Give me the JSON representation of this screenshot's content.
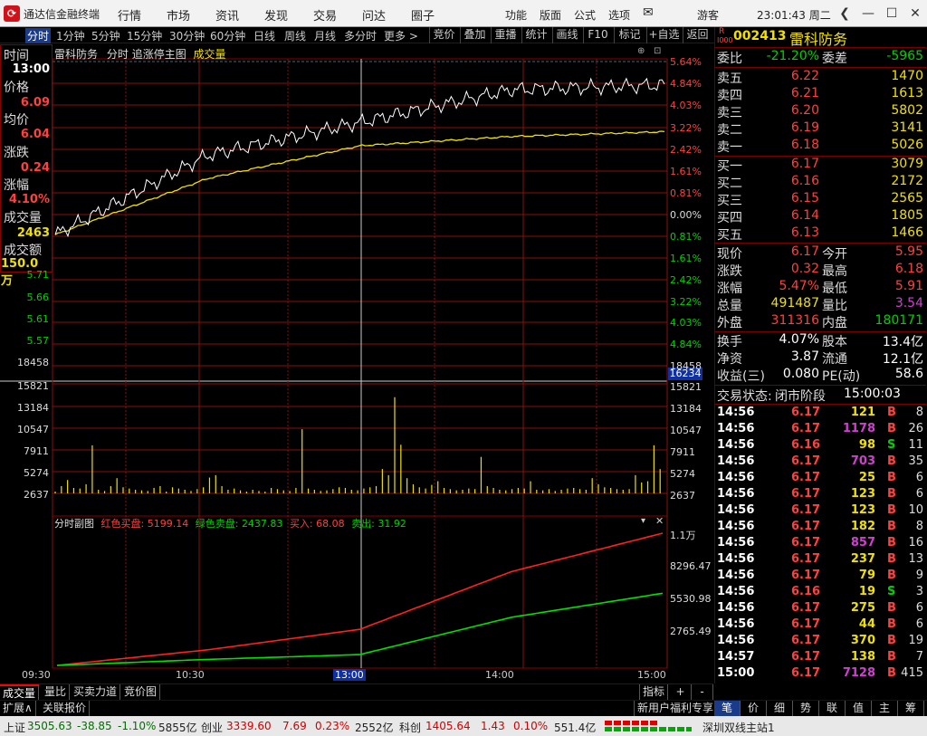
{
  "window": {
    "title": "通达信金融终端",
    "menus": [
      "行情",
      "市场",
      "资讯",
      "发现",
      "交易",
      "问达",
      "圈子"
    ],
    "sys_menus": [
      "功能",
      "版面",
      "公式",
      "选项"
    ],
    "user": "游客",
    "clock": "23:01:43 周二"
  },
  "toolbar": {
    "left": [
      "分时",
      "1分钟",
      "5分钟",
      "15分钟",
      "30分钟",
      "60分钟",
      "日线",
      "周线",
      "月线",
      "多分时",
      "更多 >"
    ],
    "right": [
      "竞价",
      "叠加",
      "重播",
      "统计",
      "画线",
      "F10",
      "标记",
      "+自选",
      "返回"
    ]
  },
  "chart": {
    "header": {
      "name": "雷科防务",
      "mode": "分时",
      "main": "追涨停主图",
      "vol": "成交量"
    },
    "info": [
      {
        "label": "时间",
        "value": "13:00",
        "color": "#ffffff"
      },
      {
        "label": "价格",
        "value": "6.09",
        "color": "#ff4040"
      },
      {
        "label": "均价",
        "value": "6.04",
        "color": "#ff4040"
      },
      {
        "label": "涨跌",
        "value": "0.24",
        "color": "#ff4040"
      },
      {
        "label": "涨幅",
        "value": "4.10%",
        "color": "#ff4040"
      },
      {
        "label": "成交量",
        "value": "2463",
        "color": "#f0e000"
      },
      {
        "label": "成交额",
        "value": "150.0万",
        "color": "#f0e000"
      }
    ],
    "left_price_ticks": [
      "5.71",
      "5.66",
      "5.61",
      "5.57",
      "18458",
      "15821",
      "13184",
      "10547",
      "7911",
      "5274",
      "2637"
    ],
    "right_pct_ticks": [
      "5.64%",
      "4.84%",
      "4.03%",
      "3.22%",
      "2.42%",
      "1.61%",
      "0.81%",
      "0.00%",
      "0.81%",
      "1.61%",
      "2.42%",
      "3.22%",
      "4.03%",
      "4.84%",
      "18458",
      "15821",
      "13184",
      "10547",
      "7911",
      "5274",
      "2637"
    ],
    "right_vol_highlight": "16234",
    "sub": {
      "title": "分时副图",
      "red_label": "红色买盘:",
      "red_val": "5199.14",
      "green_label": "绿色卖盘:",
      "green_val": "2437.83",
      "buy_label": "买入:",
      "buy_val": "68.08",
      "sell_label": "卖出:",
      "sell_val": "31.92",
      "ticks": [
        "1.1万",
        "8296.47",
        "5530.98",
        "2765.49"
      ]
    },
    "times": [
      "09:30",
      "10:30",
      "13:00",
      "14:00",
      "15:00"
    ]
  },
  "chart_data": {
    "type": "line",
    "title": "雷科防务 分时",
    "x": [
      "09:30",
      "10:30",
      "13:00",
      "14:00",
      "15:00"
    ],
    "series": [
      {
        "name": "价格",
        "color": "#ffffff",
        "values": [
          5.85,
          6.02,
          6.09,
          6.16,
          6.17
        ]
      },
      {
        "name": "均价",
        "color": "#f0e000",
        "values": [
          5.85,
          5.97,
          6.04,
          6.06,
          6.07
        ]
      },
      {
        "name": "红色买盘",
        "color": "#ff2020",
        "values": [
          0,
          1300,
          3000,
          7800,
          11000
        ]
      },
      {
        "name": "绿色卖盘",
        "color": "#00e000",
        "values": [
          0,
          500,
          900,
          4000,
          6000
        ]
      }
    ],
    "volume": [
      300,
      1200,
      2200,
      900,
      800,
      1500,
      7900,
      600,
      400,
      1200,
      2500,
      1000,
      800,
      600,
      500,
      400,
      900,
      1200,
      300,
      1000,
      800,
      600,
      400,
      700,
      1000,
      2600,
      3000,
      1200,
      600,
      800,
      500,
      300,
      600,
      400,
      300,
      900,
      700,
      500,
      400,
      900,
      10547,
      800,
      600,
      400,
      500,
      700,
      1000,
      900,
      600,
      500,
      800,
      1000,
      1200,
      4000,
      3000,
      15821,
      8000,
      2500,
      1500,
      1000,
      800,
      1400,
      2000,
      900,
      700,
      500,
      600,
      800,
      700,
      6000,
      1200,
      900,
      600,
      500,
      700,
      900,
      800,
      2000,
      600,
      500,
      700,
      400,
      600,
      800,
      900,
      700,
      600,
      2500,
      1500,
      1000,
      900,
      700,
      600,
      700,
      3000,
      1800,
      2000,
      7911,
      4000
    ],
    "ylim": [
      5.57,
      6.22
    ],
    "grid": true
  },
  "orderbook": {
    "code": "002413",
    "name": "雷科防务",
    "wb": {
      "label": "委比",
      "value": "-21.20%"
    },
    "wc": {
      "label": "委差",
      "value": "-5965"
    },
    "sells": [
      {
        "label": "卖五",
        "price": "6.22",
        "vol": "1470"
      },
      {
        "label": "卖四",
        "price": "6.21",
        "vol": "1613"
      },
      {
        "label": "卖三",
        "price": "6.20",
        "vol": "5802"
      },
      {
        "label": "卖二",
        "price": "6.19",
        "vol": "3141"
      },
      {
        "label": "卖一",
        "price": "6.18",
        "vol": "5026"
      }
    ],
    "buys": [
      {
        "label": "买一",
        "price": "6.17",
        "vol": "3079"
      },
      {
        "label": "买二",
        "price": "6.16",
        "vol": "2172"
      },
      {
        "label": "买三",
        "price": "6.15",
        "vol": "2565"
      },
      {
        "label": "买四",
        "price": "6.14",
        "vol": "1805"
      },
      {
        "label": "买五",
        "price": "6.13",
        "vol": "1466"
      }
    ]
  },
  "quote": [
    {
      "l": "现价",
      "v": "6.17",
      "vc": "#ff4040",
      "l2": "今开",
      "v2": "5.95",
      "vc2": "#ff4040"
    },
    {
      "l": "涨跌",
      "v": "0.32",
      "vc": "#ff4040",
      "l2": "最高",
      "v2": "6.18",
      "vc2": "#ff4040"
    },
    {
      "l": "涨幅",
      "v": "5.47%",
      "vc": "#ff4040",
      "l2": "最低",
      "v2": "5.91",
      "vc2": "#ff4040"
    },
    {
      "l": "总量",
      "v": "491487",
      "vc": "#f0e000",
      "l2": "量比",
      "v2": "3.54",
      "vc2": "#d040d0"
    },
    {
      "l": "外盘",
      "v": "311316",
      "vc": "#ff4040",
      "l2": "内盘",
      "v2": "180171",
      "vc2": "#00d000"
    }
  ],
  "quote2": [
    {
      "l": "换手",
      "v": "4.07%",
      "l2": "股本",
      "v2": "13.4亿"
    },
    {
      "l": "净资",
      "v": "3.87",
      "l2": "流通",
      "v2": "12.1亿"
    },
    {
      "l": "收益(三)",
      "v": "0.080",
      "l2": "PE(动)",
      "v2": "58.6"
    }
  ],
  "trade_status": {
    "label": "交易状态:",
    "value": "闭市阶段",
    "time": "15:00:03"
  },
  "ticks": [
    {
      "t": "14:56",
      "p": "6.17",
      "v": "121",
      "vc": "#f0e000",
      "s": "B",
      "n": "8"
    },
    {
      "t": "14:56",
      "p": "6.17",
      "v": "1178",
      "vc": "#d040d0",
      "s": "B",
      "n": "26"
    },
    {
      "t": "14:56",
      "p": "6.16",
      "v": "98",
      "vc": "#f0e000",
      "s": "S",
      "n": "11"
    },
    {
      "t": "14:56",
      "p": "6.17",
      "v": "703",
      "vc": "#d040d0",
      "s": "B",
      "n": "35"
    },
    {
      "t": "14:56",
      "p": "6.17",
      "v": "25",
      "vc": "#f0e000",
      "s": "B",
      "n": "6"
    },
    {
      "t": "14:56",
      "p": "6.17",
      "v": "123",
      "vc": "#f0e000",
      "s": "B",
      "n": "6"
    },
    {
      "t": "14:56",
      "p": "6.17",
      "v": "123",
      "vc": "#f0e000",
      "s": "B",
      "n": "10"
    },
    {
      "t": "14:56",
      "p": "6.17",
      "v": "182",
      "vc": "#f0e000",
      "s": "B",
      "n": "8"
    },
    {
      "t": "14:56",
      "p": "6.17",
      "v": "857",
      "vc": "#d040d0",
      "s": "B",
      "n": "16"
    },
    {
      "t": "14:56",
      "p": "6.17",
      "v": "237",
      "vc": "#f0e000",
      "s": "B",
      "n": "13"
    },
    {
      "t": "14:56",
      "p": "6.17",
      "v": "79",
      "vc": "#f0e000",
      "s": "B",
      "n": "9"
    },
    {
      "t": "14:56",
      "p": "6.16",
      "v": "19",
      "vc": "#f0e000",
      "s": "S",
      "n": "3"
    },
    {
      "t": "14:56",
      "p": "6.17",
      "v": "275",
      "vc": "#f0e000",
      "s": "B",
      "n": "6"
    },
    {
      "t": "14:56",
      "p": "6.17",
      "v": "44",
      "vc": "#f0e000",
      "s": "B",
      "n": "6"
    },
    {
      "t": "14:56",
      "p": "6.17",
      "v": "370",
      "vc": "#f0e000",
      "s": "B",
      "n": "19"
    },
    {
      "t": "14:57",
      "p": "6.17",
      "v": "138",
      "vc": "#f0e000",
      "s": "B",
      "n": "7"
    },
    {
      "t": "15:00",
      "p": "6.17",
      "v": "7128",
      "vc": "#d040d0",
      "s": "B",
      "n": "415"
    }
  ],
  "bottom_tabs": [
    "成交量",
    "量比",
    "买卖力道",
    "竞价图"
  ],
  "bottom_right": [
    "指标",
    "+",
    "-"
  ],
  "bottom2": {
    "left": [
      "扩展∧",
      "关联报价"
    ],
    "promo": "新用户福利专享",
    "right_tabs": [
      "笔",
      "价",
      "细",
      "势",
      "联",
      "值",
      "主",
      "筹"
    ]
  },
  "status": {
    "sh_label": "上证",
    "sh": "3505.63",
    "sh_chg": "-38.85",
    "sh_pct": "-1.10%",
    "sh_amt": "5855亿",
    "cy_label": "创业",
    "cy": "3339.60",
    "cy_chg": "7.69",
    "cy_pct": "0.23%",
    "cy_amt": "2552亿",
    "kc_label": "科创",
    "kc": "1405.64",
    "kc_chg": "1.43",
    "kc_pct": "0.10%",
    "kc_amt": "551.4亿",
    "server": "深圳双线主站1"
  }
}
